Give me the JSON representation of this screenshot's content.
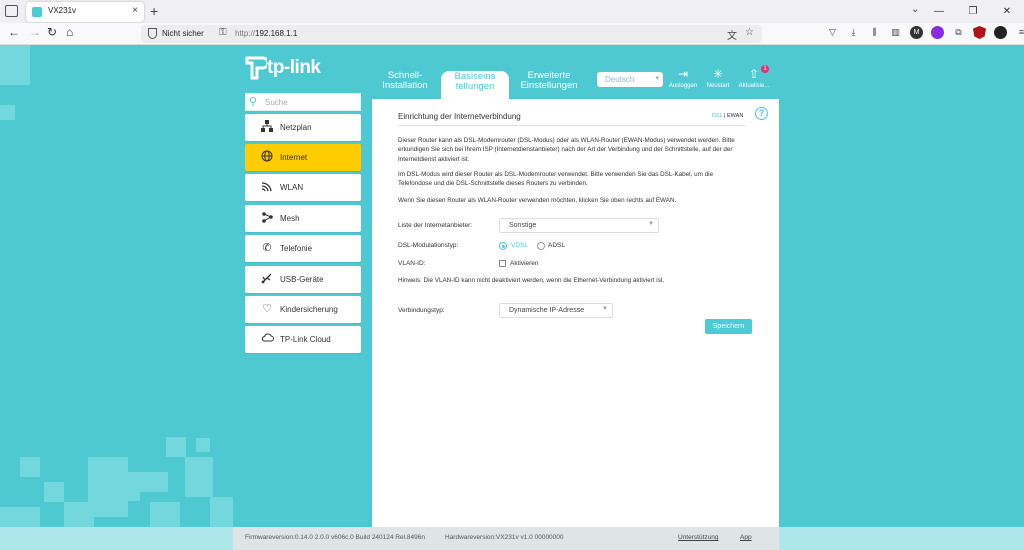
{
  "browser": {
    "tab_title": "VX231v",
    "tab_close": "×",
    "new_tab": "+",
    "not_secure": "Nicht sicher",
    "url_prefix": "http://",
    "url_host": "192.168.1.1",
    "win_minimize": "—",
    "win_restore": "❐",
    "win_close": "✕",
    "nav_back": "←",
    "nav_forward": "→",
    "nav_reload": "↻",
    "nav_home": "⌂"
  },
  "brand": {
    "logo_text": "tp-link"
  },
  "top_tabs": [
    {
      "label": "Schnell-\nInstallation"
    },
    {
      "label": "Basiseins\ntellungen"
    },
    {
      "label": "Erweiterte\nEinstellungen"
    }
  ],
  "language": {
    "value": "Deutsch"
  },
  "tools": {
    "logout": "Ausloggen",
    "reboot": "Neustart",
    "update": "Aktualisie...",
    "update_badge": "1"
  },
  "sidebar": {
    "search_placeholder": "Suche",
    "items": [
      {
        "label": "Netzplan",
        "icon": "network-map-icon"
      },
      {
        "label": "Internet",
        "icon": "globe-icon"
      },
      {
        "label": "WLAN",
        "icon": "wifi-icon"
      },
      {
        "label": "Mesh",
        "icon": "mesh-icon"
      },
      {
        "label": "Telefonie",
        "icon": "phone-icon"
      },
      {
        "label": "USB-Geräte",
        "icon": "usb-icon"
      },
      {
        "label": "Kindersicherung",
        "icon": "heart-icon"
      },
      {
        "label": "TP-Link Cloud",
        "icon": "cloud-icon"
      }
    ],
    "active_index": 1
  },
  "main": {
    "title": "Einrichtung der Internetverbindung",
    "mode_dsl": "DSL",
    "mode_sep": "|",
    "mode_ewan": "EWAN",
    "help": "?",
    "para1": "Dieser Router kann als DSL-Modemrouter (DSL-Modus) oder als WLAN-Router (EWAN-Modus) verwendet werden. Bitte erkundigen Sie sich bei Ihrem ISP (Internetdienstanbieter) nach der Art der Verbindung und der Schnittstelle, auf der der Internetdienst aktiviert ist.",
    "para2": "Im DSL-Modus wird dieser Router als DSL-Modemrouter verwendet. Bitte verwenden Sie das DSL-Kabel, um die Telefondose und die DSL-Schnittstelle dieses Routers zu verbinden.",
    "para3": "Wenn Sie diesen Router als WLAN-Router verwenden möchten, klicken Sie oben rechts auf EWAN.",
    "isp_label": "Liste der Internetanbieter:",
    "isp_value": "Sonstige",
    "mod_label": "DSL-Modulationstyp:",
    "mod_vdsl": "VDSL",
    "mod_adsl": "ADSL",
    "vlan_label": "VLAN-ID:",
    "vlan_enable": "Aktivieren",
    "hint": "Hinweis: Die VLAN-ID kann nicht deaktiviert werden, wenn die Ethernet-Verbindung aktiviert ist.",
    "conn_label": "Verbindungstyp:",
    "conn_value": "Dynamische IP-Adresse",
    "save": "Speichern"
  },
  "footer": {
    "firmware": "Firmwareversion:0.14.0 2.0.0 v606c.0 Build 240124 Rel.8496n",
    "hardware": "Hardwareversion:VX231v v1.0 00000000",
    "support": "Unterstützung",
    "app": "App"
  },
  "colors": {
    "accent": "#4acbd6",
    "active_item": "#ffcc00",
    "page_bg": "#4ec9d2"
  }
}
